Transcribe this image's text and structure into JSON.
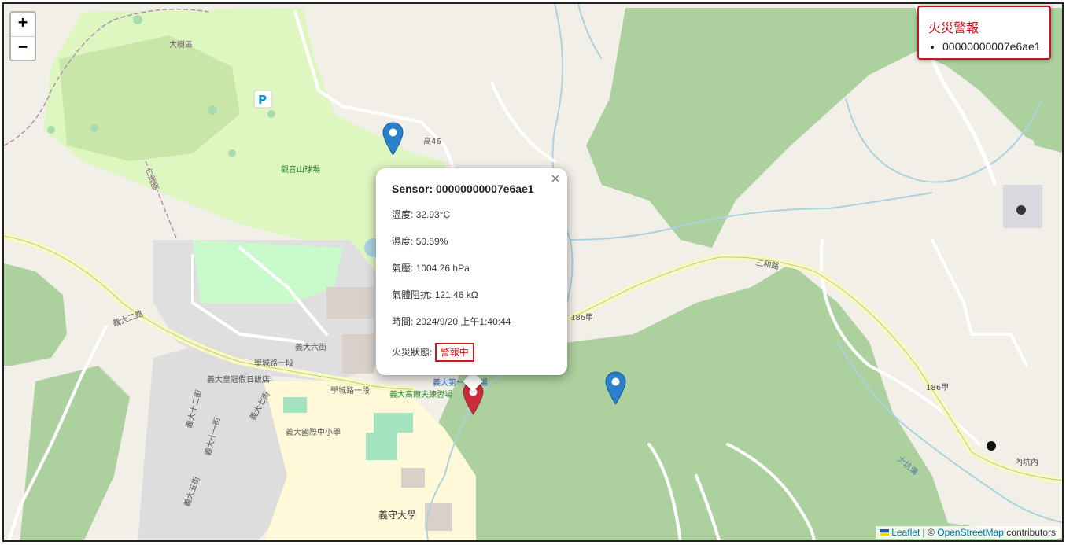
{
  "zoom": {
    "in_label": "+",
    "out_label": "−"
  },
  "alert_panel": {
    "title": "火災警報",
    "sensors": [
      "00000000007e6ae1"
    ]
  },
  "popup": {
    "close_label": "×",
    "sensor_label": "Sensor:",
    "sensor_id": "00000000007e6ae1",
    "temperature_label": "溫度:",
    "temperature": "32.93°C",
    "humidity_label": "濕度:",
    "humidity": "50.59%",
    "pressure_label": "氣壓:",
    "pressure": "1004.26 hPa",
    "gas_label": "氣體阻抗:",
    "gas": "121.46 kΩ",
    "time_label": "時間:",
    "time": "2024/9/20 上午1:40:44",
    "fire_label": "火災狀態:",
    "fire_status": "警報中"
  },
  "markers": [
    {
      "color": "#2a81cb",
      "status": "normal"
    },
    {
      "color": "#2a81cb",
      "status": "normal"
    },
    {
      "color": "#cb2b3e",
      "status": "alarm"
    }
  ],
  "map_labels": {
    "gaoshu": "大樹區",
    "renwu": "仁武區",
    "golf": "觀音山球場",
    "road_gao46": "高46",
    "road_sanhe": "三和路",
    "road_186a": "186甲",
    "road_186a_2": "186甲",
    "neikengnei": "內坑內",
    "dakeng": "大坑溝",
    "yida2": "義大二路",
    "yida6": "義大六街",
    "xuecheng1": "學城路一段",
    "xuecheng2": "學城路一段",
    "hotel": "義大皇冠假日飯店",
    "school": "義大國際中小學",
    "golf_practice": "義大高爾夫練習場",
    "parking": "義大第一停車場",
    "university": "義守大學",
    "yida7": "義大七街",
    "yida11": "義大十一街",
    "yida12": "義大十二街",
    "yida5": "義大五街",
    "parking_p": "P"
  },
  "attribution": {
    "leaflet": "Leaflet",
    "sep": " | © ",
    "osm": "OpenStreetMap",
    "contrib": " contributors"
  }
}
